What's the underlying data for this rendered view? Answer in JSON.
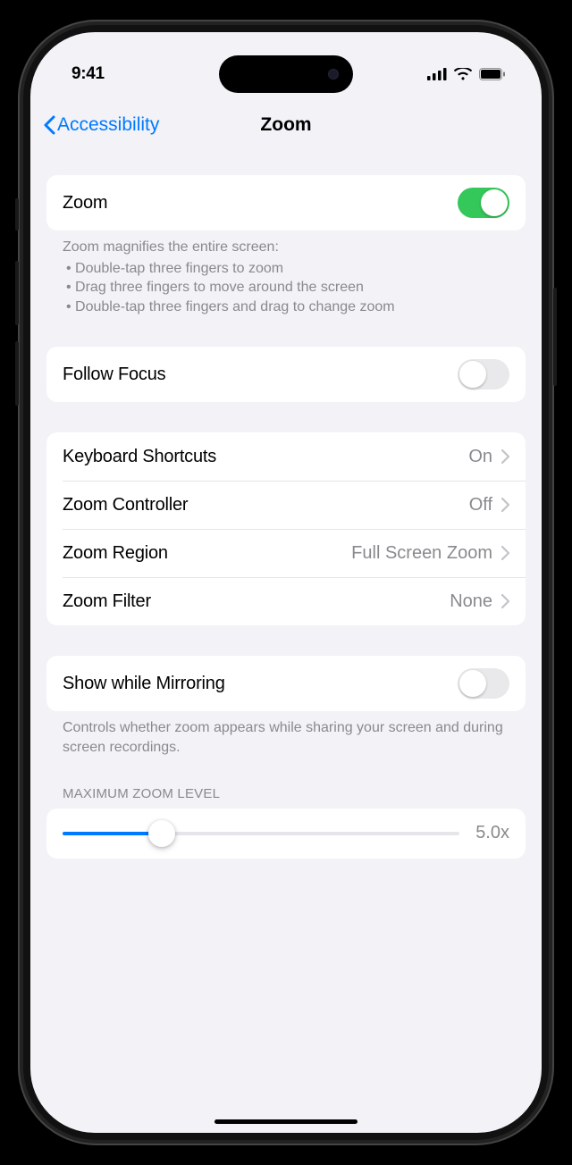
{
  "status": {
    "time": "9:41"
  },
  "nav": {
    "back": "Accessibility",
    "title": "Zoom"
  },
  "zoom_toggle": {
    "label": "Zoom",
    "on": true
  },
  "zoom_footer": {
    "intro": "Zoom magnifies the entire screen:",
    "bullets": [
      "Double-tap three fingers to zoom",
      "Drag three fingers to move around the screen",
      "Double-tap three fingers and drag to change zoom"
    ]
  },
  "follow_focus": {
    "label": "Follow Focus",
    "on": false
  },
  "options": [
    {
      "label": "Keyboard Shortcuts",
      "value": "On"
    },
    {
      "label": "Zoom Controller",
      "value": "Off"
    },
    {
      "label": "Zoom Region",
      "value": "Full Screen Zoom"
    },
    {
      "label": "Zoom Filter",
      "value": "None"
    }
  ],
  "mirroring": {
    "label": "Show while Mirroring",
    "on": false,
    "footer": "Controls whether zoom appears while sharing your screen and during screen recordings."
  },
  "max_zoom": {
    "header": "MAXIMUM ZOOM LEVEL",
    "value_label": "5.0x",
    "fill_percent": 25
  }
}
